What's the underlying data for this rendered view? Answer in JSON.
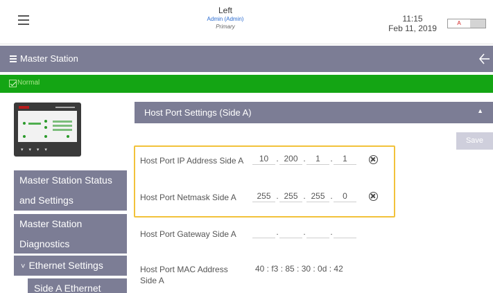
{
  "header": {
    "device_name": "Left",
    "user": "Admin (Admin)",
    "role": "Primary",
    "time": "11:15",
    "date": "Feb 11, 2019",
    "side_toggle": {
      "selected": "A"
    }
  },
  "titlebar": {
    "title": "Master Station"
  },
  "status": {
    "text": "Normal",
    "color": "#14a514"
  },
  "sidebar": {
    "items": [
      {
        "line1": "Master Station Status",
        "line2": "and Settings"
      },
      {
        "line1": "Master Station",
        "line2": "Diagnostics"
      },
      {
        "label": "Ethernet Settings",
        "expanded": true
      },
      {
        "label": "Side A Ethernet"
      }
    ]
  },
  "panel": {
    "title": "Host Port Settings (Side A)",
    "save_label": "Save",
    "fields": [
      {
        "label": "Host Port IP Address Side A",
        "octets": [
          "10",
          "200",
          "1",
          "1"
        ]
      },
      {
        "label": "Host Port Netmask Side A",
        "octets": [
          "255",
          "255",
          "255",
          "0"
        ]
      },
      {
        "label": "Host Port Gateway Side A",
        "octets": [
          "",
          "",
          "",
          ""
        ]
      },
      {
        "label": "Host Port MAC Address Side A",
        "value": "40 : f3 : 85 : 30 : 0d : 42"
      }
    ],
    "field_separator": "."
  },
  "colors": {
    "accent": "#7c7d95",
    "highlight": "#f2c23a",
    "ok": "#14a514"
  }
}
